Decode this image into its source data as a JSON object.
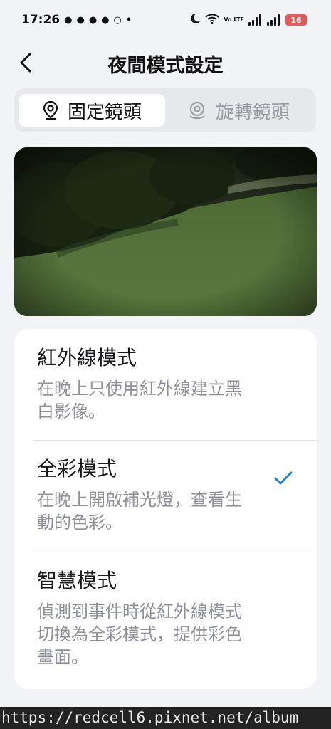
{
  "status_bar": {
    "time": "17:26",
    "battery": "16",
    "signal_label": "Vo LTE"
  },
  "header": {
    "title": "夜間模式設定",
    "back_icon": "chevron-left-icon"
  },
  "tabs": [
    {
      "label": "固定鏡頭",
      "icon": "location-pin-icon",
      "active": true
    },
    {
      "label": "旋轉鏡頭",
      "icon": "rotating-camera-icon",
      "active": false
    }
  ],
  "modes": [
    {
      "title": "紅外線模式",
      "desc_line1": "在晚上只使用紅外線建立黑",
      "desc_line2": "白影像。",
      "desc_line3": "",
      "selected": false
    },
    {
      "title": "全彩模式",
      "desc_line1": "在晚上開啟補光燈，查看生",
      "desc_line2": "動的色彩。",
      "desc_line3": "",
      "selected": true
    },
    {
      "title": "智慧模式",
      "desc_line1": "偵測到事件時從紅外線模式",
      "desc_line2": "切換為全彩模式，提供彩色",
      "desc_line3": "畫面。",
      "selected": false
    }
  ],
  "colors": {
    "accent": "#2b7fc4",
    "background": "#f2f3f7"
  },
  "watermark": "https://redcell6.pixnet.net/album"
}
